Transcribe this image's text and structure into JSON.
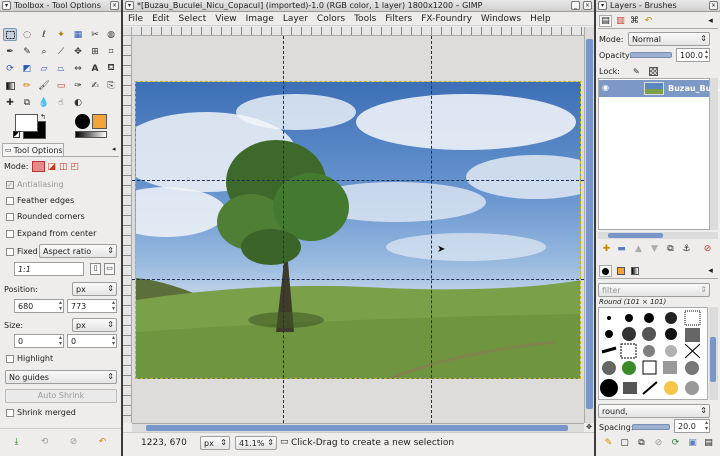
{
  "toolbox": {
    "title": "Toolbox - Tool Options",
    "tab_label": "Tool Options",
    "mode_label": "Mode:",
    "antialiasing": "Antialiasing",
    "feather_edges": "Feather edges",
    "rounded_corners": "Rounded corners",
    "expand_from_center": "Expand from center",
    "fixed_label": "Fixed",
    "fixed_value": "Aspect ratio",
    "ratio_value": "1:1",
    "position_label": "Position:",
    "position_unit": "px",
    "position_x": "680",
    "position_y": "773",
    "size_label": "Size:",
    "size_unit": "px",
    "size_w": "0",
    "size_h": "0",
    "highlight_label": "Highlight",
    "guides_value": "No guides",
    "auto_shrink_label": "Auto Shrink",
    "shrink_merged_label": "Shrink merged"
  },
  "image_window": {
    "title": "*[Buzau_Buculei_Nicu_Copacul] (imported)-1.0 (RGB color, 1 layer) 1800x1200 – GIMP",
    "menu": [
      "File",
      "Edit",
      "Select",
      "View",
      "Image",
      "Layer",
      "Colors",
      "Tools",
      "Filters",
      "FX-Foundry",
      "Windows",
      "Help"
    ],
    "coords": "1223, 670",
    "unit": "px",
    "zoom": "41.1%",
    "status": "Click-Drag to create a new selection"
  },
  "layers": {
    "title": "Layers - Brushes",
    "mode_label": "Mode:",
    "mode_value": "Normal",
    "opacity_label": "Opacity:",
    "opacity_value": "100.0",
    "lock_label": "Lock:",
    "layer_name": "Buzau_Bucu",
    "filter_placeholder": "filter",
    "brush_name": "Round (101 × 101)",
    "brush_combo": "round,",
    "spacing_label": "Spacing:",
    "spacing_value": "20.0"
  },
  "colors": {
    "accent": "#c5d0e1",
    "layer_selected": "#7c98c4",
    "fg_color": "#000000",
    "bg_color": "#ffffff",
    "pattern_color": "#f2a33a"
  }
}
